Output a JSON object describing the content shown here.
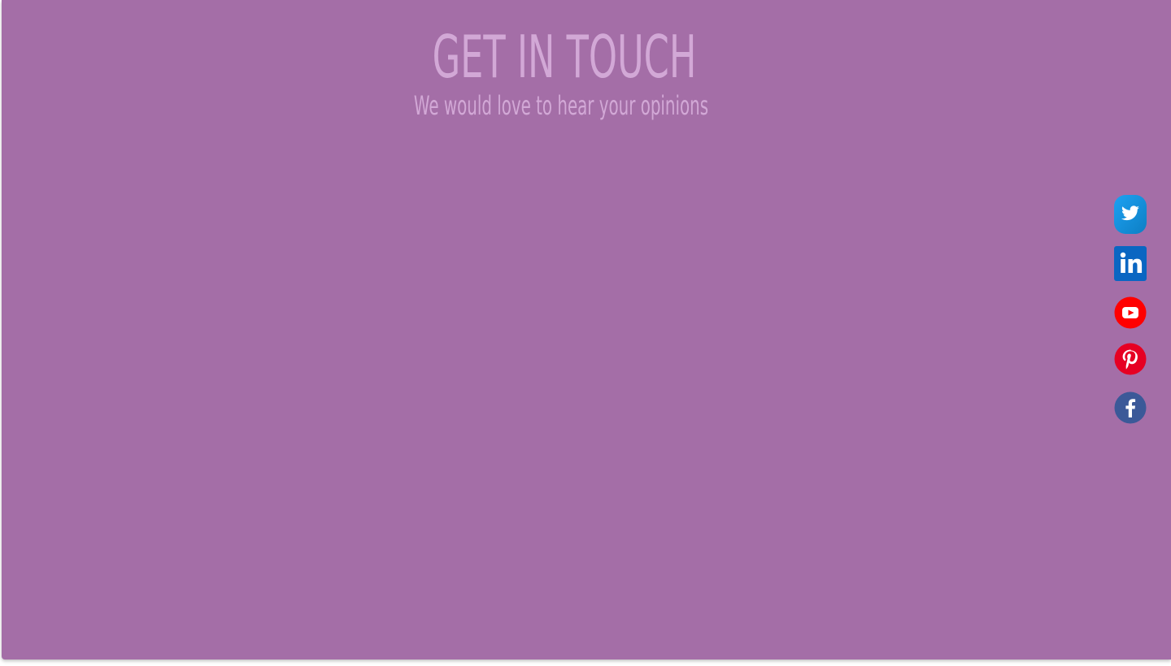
{
  "contact": {
    "title": "GET IN TOUCH",
    "subtitle": "We would love to hear your opinions"
  },
  "social_bar": {
    "items": [
      {
        "icon": "twitter-icon",
        "color": "#1da1f2"
      },
      {
        "icon": "linkedin-icon",
        "color": "#0a66c2"
      },
      {
        "icon": "youtube-icon",
        "color": "#ff0000"
      },
      {
        "icon": "pinterest-icon",
        "color": "#e60023"
      },
      {
        "icon": "facebook-icon",
        "color": "#3b5998"
      }
    ]
  },
  "colors": {
    "background": "#a46ea7",
    "heading_text": "#d2a8d6"
  }
}
